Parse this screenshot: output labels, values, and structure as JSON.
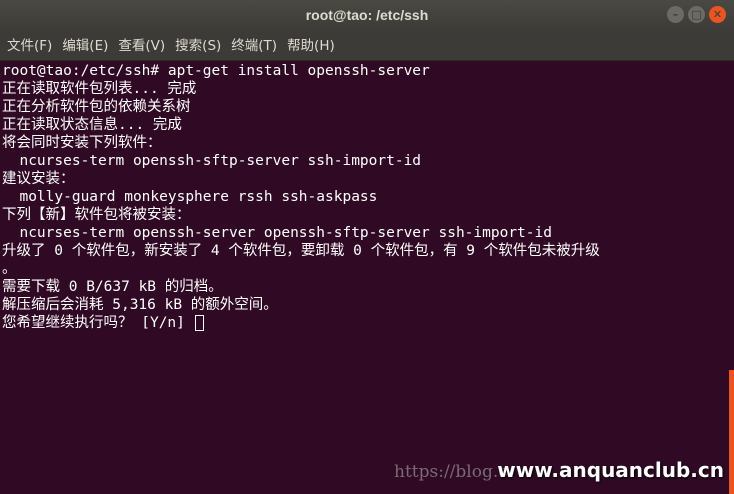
{
  "window": {
    "title": "root@tao: /etc/ssh",
    "minimize_glyph": "–",
    "maximize_glyph": "□",
    "close_glyph": "✕"
  },
  "menu": {
    "items": [
      {
        "label": "文件(F)"
      },
      {
        "label": "编辑(E)"
      },
      {
        "label": "查看(V)"
      },
      {
        "label": "搜索(S)"
      },
      {
        "label": "终端(T)"
      },
      {
        "label": "帮助(H)"
      }
    ]
  },
  "terminal": {
    "lines": [
      "root@tao:/etc/ssh# apt-get install openssh-server",
      "正在读取软件包列表... 完成",
      "正在分析软件包的依赖关系树",
      "正在读取状态信息... 完成",
      "将会同时安装下列软件：",
      "  ncurses-term openssh-sftp-server ssh-import-id",
      "建议安装：",
      "  molly-guard monkeysphere rssh ssh-askpass",
      "下列【新】软件包将被安装：",
      "  ncurses-term openssh-server openssh-sftp-server ssh-import-id",
      "升级了 0 个软件包，新安装了 4 个软件包，要卸载 0 个软件包，有 9 个软件包未被升级",
      "。",
      "需要下载 0 B/637 kB 的归档。",
      "解压缩后会消耗 5,316 kB 的额外空间。"
    ],
    "prompt": "您希望继续执行吗？ [Y/n] "
  },
  "watermarks": {
    "faint": "https://blog.c",
    "bold": "www.anquanclub.cn"
  },
  "colors": {
    "terminal_bg": "#300a24",
    "titlebar_bg": "#3c3b37",
    "accent": "#e95420",
    "text": "#ffffff"
  }
}
